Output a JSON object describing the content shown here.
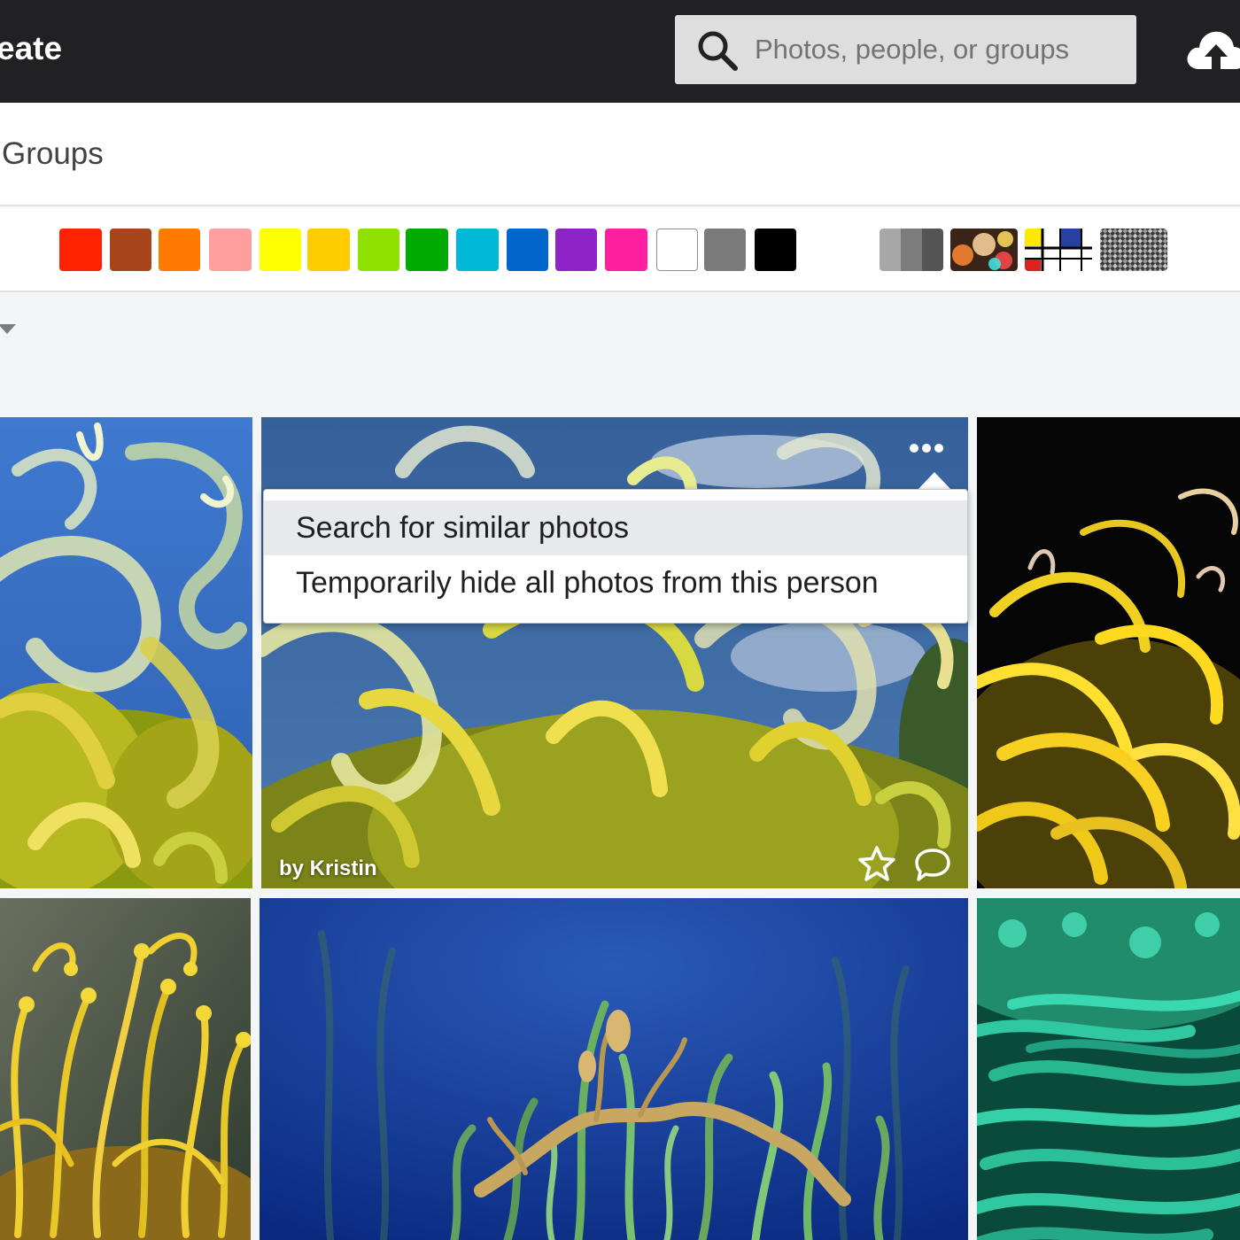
{
  "header": {
    "create_label": "eate",
    "search_placeholder": "Photos, people, or groups",
    "icons": {
      "search": "search-icon",
      "upload": "cloud-upload-icon"
    }
  },
  "tabs": {
    "groups_label": "Groups"
  },
  "color_filters": {
    "solid": [
      "#ff2200",
      "#a6441a",
      "#ff7b00",
      "#ff9e9e",
      "#ffff00",
      "#ffcc00",
      "#90e100",
      "#00aa00",
      "#00b8d8",
      "#0066cc",
      "#8e24c8",
      "#ff1fa0",
      "#ffffff",
      "#7a7a7a",
      "#000000"
    ],
    "style_filters": [
      "black-and-white",
      "shallow-depth-of-field",
      "minimalist",
      "patterns"
    ]
  },
  "sort": {
    "icon": "caret-down-icon"
  },
  "photos": [
    {
      "name": "chihuly-glass-blue-sky",
      "credit": ""
    },
    {
      "name": "chihuly-glass-yellow-tendrils",
      "credit": "by Kristin"
    },
    {
      "name": "chihuly-glass-black-background",
      "credit": ""
    },
    {
      "name": "yellow-anemone",
      "credit": ""
    },
    {
      "name": "weedy-sea-dragon",
      "credit": ""
    },
    {
      "name": "green-anemone",
      "credit": ""
    }
  ],
  "context_menu": {
    "items": [
      "Search for similar photos",
      "Temporarily hide all photos from this person"
    ]
  }
}
